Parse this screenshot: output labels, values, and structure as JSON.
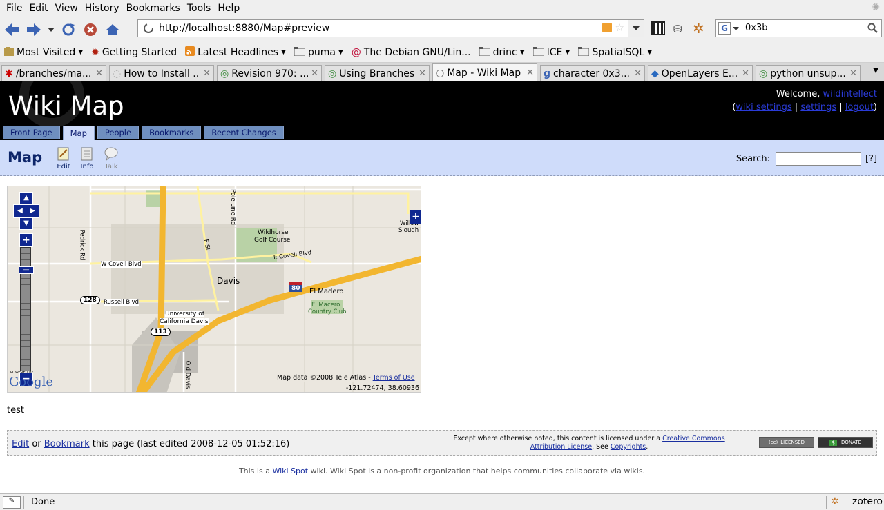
{
  "menu": [
    "File",
    "Edit",
    "View",
    "History",
    "Bookmarks",
    "Tools",
    "Help"
  ],
  "url": "http://localhost:8880/Map#preview",
  "search_engine_text": "0x3b",
  "bookmarks": [
    {
      "label": "Most Visited",
      "dropdown": true,
      "icon": "star-icon"
    },
    {
      "label": "Getting Started",
      "dropdown": false,
      "icon": "firefox-icon"
    },
    {
      "label": "Latest Headlines",
      "dropdown": true,
      "icon": "rss-icon"
    },
    {
      "label": "puma",
      "dropdown": true,
      "icon": "folder-icon"
    },
    {
      "label": "The Debian GNU/Lin...",
      "dropdown": false,
      "icon": "debian-icon"
    },
    {
      "label": "drinc",
      "dropdown": true,
      "icon": "folder-icon"
    },
    {
      "label": "ICE",
      "dropdown": true,
      "icon": "folder-icon"
    },
    {
      "label": "SpatialSQL",
      "dropdown": true,
      "icon": "folder-icon"
    }
  ],
  "tabs": [
    {
      "title": "/branches/ma...",
      "active": false
    },
    {
      "title": "How to Install ...",
      "active": false
    },
    {
      "title": "Revision 970: ...",
      "active": false
    },
    {
      "title": "Using Branches",
      "active": false
    },
    {
      "title": "Map - Wiki Map",
      "active": true
    },
    {
      "title": "character 0x3...",
      "active": false
    },
    {
      "title": "OpenLayers E...",
      "active": false
    },
    {
      "title": "python unsup...",
      "active": false
    }
  ],
  "site": {
    "logo": "Wiki Map",
    "welcome_prefix": "Welcome, ",
    "username": "wildintellect",
    "links": [
      "wiki settings",
      "settings",
      "logout"
    ],
    "nav": [
      "Front Page",
      "Map",
      "People",
      "Bookmarks",
      "Recent Changes"
    ],
    "active_nav": "Map"
  },
  "page": {
    "title": "Map",
    "actions": [
      "Edit",
      "Info",
      "Talk"
    ],
    "search_label": "Search:",
    "search_help": "[?]",
    "content": "test"
  },
  "map": {
    "labels": {
      "davis": "Davis",
      "wildhorse": "Wildhorse",
      "golf": "Golf Course",
      "covell_w": "W Covell Blvd",
      "covell_e": "E Covell Blvd",
      "russell": "Russell Blvd",
      "ucd1": "University of",
      "ucd2": "California Davis",
      "el_madero": "El Madero",
      "el_macero1": "El Macero",
      "el_macero2": "Country Club",
      "pedrick": "Pedrick Rd",
      "pole_line": "Pole Line Rd",
      "fst": "F St",
      "old_davis": "Old Davis",
      "willow": "Willow",
      "slough": "Slough",
      "hwy128": "128",
      "hwy113": "113",
      "i80": "80",
      "powered": "POWERED BY",
      "google": "Google",
      "copyright": "Map data ©2008 Tele Atlas - ",
      "terms": "Terms of Use",
      "coords": "-121.72474, 38.60936"
    }
  },
  "footer": {
    "edit": "Edit",
    "or": " or ",
    "bookmark": "Bookmark",
    "rest": " this page (last edited 2008-12-05 01:52:16)",
    "license_pre": "Except where otherwise noted, this content is licensed under a ",
    "license_link": "Creative Commons Attribution License",
    "see": ". See ",
    "copyrights": "Copyrights",
    "dot": ".",
    "badge1": "LICENSED",
    "badge2": "DONATE"
  },
  "wikispot": {
    "pre": "This is a ",
    "link": "Wiki Spot",
    "post": " wiki. Wiki Spot is a non-profit organization that helps communities collaborate via wikis."
  },
  "status": "Done",
  "zotero": "zotero"
}
